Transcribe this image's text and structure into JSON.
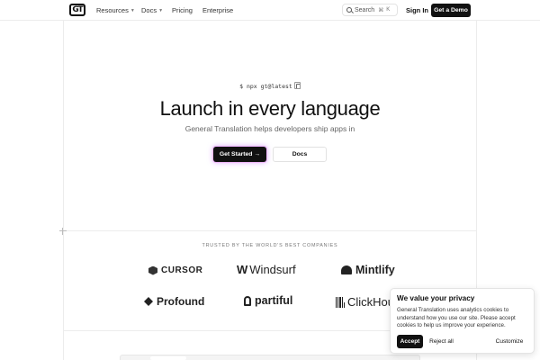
{
  "header": {
    "logo_text": "GT",
    "nav": [
      {
        "label": "Resources",
        "has_dropdown": true
      },
      {
        "label": "Docs",
        "has_dropdown": true
      },
      {
        "label": "Pricing",
        "has_dropdown": false
      },
      {
        "label": "Enterprise",
        "has_dropdown": false
      }
    ],
    "search_label": "Search",
    "search_shortcut_mod": "⌘",
    "search_shortcut_key": "K",
    "signin_label": "Sign In",
    "demo_label": "Get a Demo"
  },
  "hero": {
    "command": "$ npx gt@latest",
    "title": "Launch in every language",
    "subtitle": "General Translation helps developers ship apps in",
    "primary_label": "Get Started →",
    "secondary_label": "Docs"
  },
  "trusted": {
    "heading": "TRUSTED BY THE WORLD'S BEST COMPANIES",
    "logos": [
      "CURSOR",
      "Windsurf",
      "Mintlify",
      "Profound",
      "partiful",
      "ClickHou"
    ]
  },
  "cookie": {
    "title": "We value your privacy",
    "text": "General Translation uses analytics cookies to understand how you use our site. Please accept cookies to help us improve your experience.",
    "accept_label": "Accept",
    "reject_label": "Reject all",
    "customize_label": "Customize"
  },
  "colors": {
    "primary": "#111111",
    "border": "#ececec",
    "glow": "#d98cff"
  }
}
